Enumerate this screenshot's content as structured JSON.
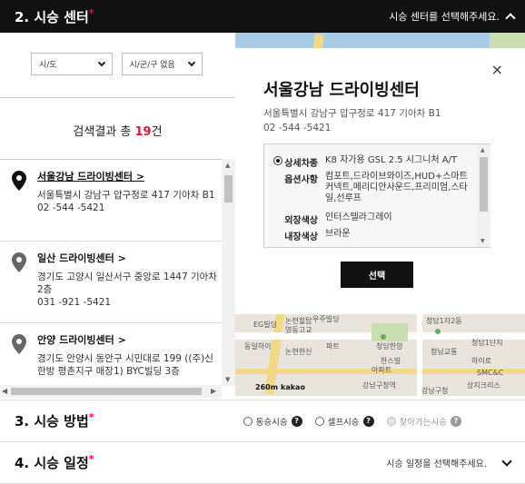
{
  "header": {
    "title": "2. 시승 센터",
    "required_mark": "*",
    "prompt": "시승 센터를 선택해주세요."
  },
  "filters": {
    "region": "시/도",
    "district": "시/군/구 없음"
  },
  "results": {
    "prefix": "검색결과 총 ",
    "count": "19",
    "suffix": "건"
  },
  "centers": [
    {
      "name": "서울강남 드라이빙센터 >",
      "address": "서울특별시 강남구 압구정로 417 기아차 B1",
      "tel": "02 -544 -5421"
    },
    {
      "name": "일산 드라이빙센터 >",
      "address": "경기도 고양시 일산서구 중앙로 1447 기아차 2층",
      "tel": "031 -921 -5421"
    },
    {
      "name": "안양 드라이빙센터 >",
      "address": "경기도 안양시 동안구 시민대로 199 ((주)신한방 평촌지구 매장1) BYC빌딩 3층",
      "tel": ""
    }
  ],
  "popup": {
    "name": "서울강남 드라이빙센터",
    "address": "서울특별시 강남구 압구정로 417 기아차 B1",
    "tel": "02 -544 -5421",
    "specs": {
      "model_label": "상세차종",
      "model": "K8 자가용 GSL 2.5 시그니처 A/T",
      "options_label": "옵션사항",
      "options": "컴포트,드라이브와이즈,HUD+스마트커넥트,메리디안사운드,프리미엄,스타일,선루프",
      "ext_label": "외장색상",
      "ext": "인터스텔라그레이",
      "int_label": "내장색상",
      "int": "브라운"
    },
    "select_button": "선택",
    "close_icon": "×"
  },
  "map": {
    "labels": [
      "논현힐탑",
      "영동고교",
      "청담1자2동",
      "EG빌딩",
      "논현한신",
      "한스빌",
      "청담1단지",
      "청남교통",
      "청담한양",
      "파트",
      "동일하이",
      "우주빌딩",
      "하이로",
      "SMC&C",
      "상지크리스",
      "강남구청",
      "강남구청역",
      "아파트"
    ],
    "scale": "260m",
    "brand": "kakao"
  },
  "sections": {
    "method": {
      "title": "3. 시승 방법",
      "required_mark": "*",
      "options": [
        {
          "label": "동승시승",
          "help": "?",
          "disabled": false
        },
        {
          "label": "셀프시승",
          "help": "?",
          "disabled": false
        },
        {
          "label": "찾아가는시승",
          "help": "?",
          "disabled": true
        }
      ]
    },
    "schedule": {
      "title": "4. 시승 일정",
      "required_mark": "*",
      "prompt": "시승 일정을 선택해주세요."
    }
  },
  "colors": {
    "accent": "#e0153a",
    "dark": "#111111"
  }
}
